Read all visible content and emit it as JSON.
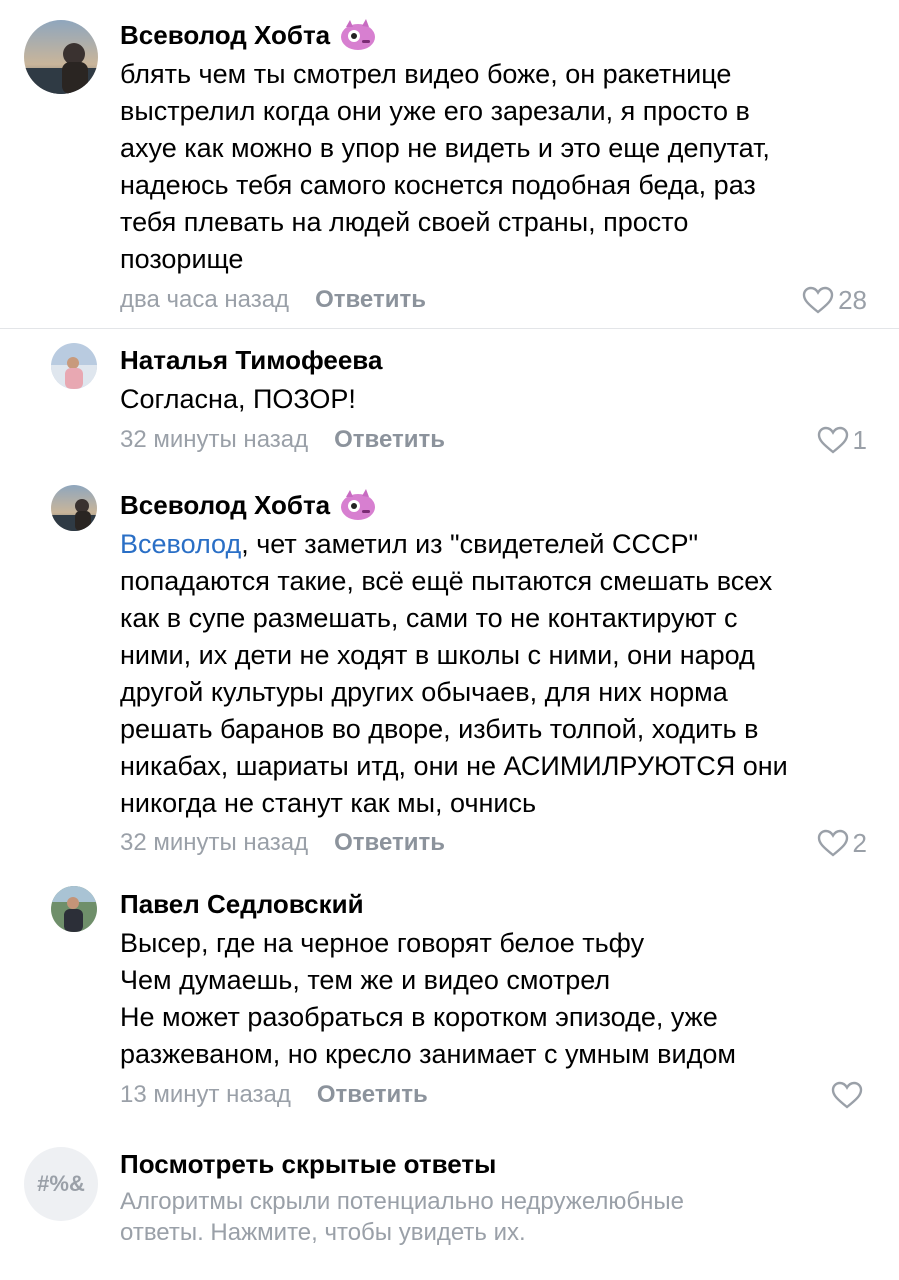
{
  "comments": [
    {
      "author": "Всеволод Хобта",
      "lines": [
        "блять чем ты смотрел видео боже, он ракетнице",
        "выстрелил когда они уже его зарезали, я просто в",
        "ахуе как можно в упор не видеть и это еще депутат,",
        "надеюсь тебя самого коснется подобная беда, раз",
        "тебя плевать на людей своей страны, просто",
        "позорище"
      ],
      "time": "два часа назад",
      "reply": "Ответить",
      "likes": "28"
    },
    {
      "author": "Наталья Тимофеева",
      "lines": [
        "Согласна, ПОЗОР!"
      ],
      "time": "32 минуты назад",
      "reply": "Ответить",
      "likes": "1"
    },
    {
      "author": "Всеволод Хобта",
      "mention": "Всеволод",
      "lines": [
        ", чет заметил из \"свидетелей СССР\"",
        "попадаются такие, всё ещё пытаются смешать всех",
        "как в супе размешать, сами то не контактируют с",
        "ними, их дети не ходят в школы с ними, они народ",
        "другой культуры других обычаев, для них норма",
        "решать баранов во дворе, избить толпой, ходить в",
        "никабах, шариаты итд, они не АСИМИЛРУЮТСЯ они",
        "никогда не станут как мы, очнись"
      ],
      "time": "32 минуты назад",
      "reply": "Ответить",
      "likes": "2"
    },
    {
      "author": "Павел Седловский",
      "lines": [
        "Высер, где на черное говорят белое тьфу",
        "Чем думаешь, тем же и видео смотрел",
        "Не может разобраться в коротком эпизоде, уже",
        "разжеваном, но кресло занимает с умным видом"
      ],
      "time": "13 минут назад",
      "reply": "Ответить",
      "likes": ""
    }
  ],
  "hidden": {
    "icon_text": "#%&",
    "title": "Посмотреть скрытые ответы",
    "desc_1": "Алгоритмы скрыли потенциально недружелюбные",
    "desc_2": "ответы. Нажмите, чтобы увидеть их."
  },
  "colors": {
    "mention": "#2a6fc6",
    "secondary": "#9aa0a8",
    "divider": "#e3e5e8"
  },
  "icons": [
    "heart-icon",
    "sticker-badge-icon",
    "hidden-replies-icon"
  ]
}
